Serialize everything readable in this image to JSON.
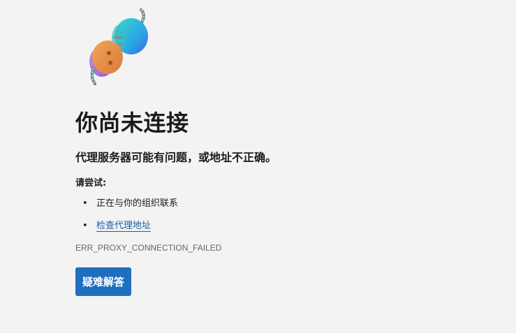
{
  "page": {
    "title": "你尚未连接",
    "subtitle": "代理服务器可能有问题，或地址不正确。",
    "try_label": "请尝试:",
    "suggestions": [
      {
        "text": "正在与你的组织联系",
        "is_link": false
      },
      {
        "text": "检查代理地址",
        "is_link": true
      }
    ],
    "error_code": "ERR_PROXY_CONNECTION_FAILED",
    "troubleshoot_button": "疑难解答"
  },
  "colors": {
    "accent": "#1f6fc0",
    "link": "#1a5ea6",
    "background": "#f3f3f3"
  },
  "icons": {
    "illustration": "disconnected-plug-illustration"
  }
}
